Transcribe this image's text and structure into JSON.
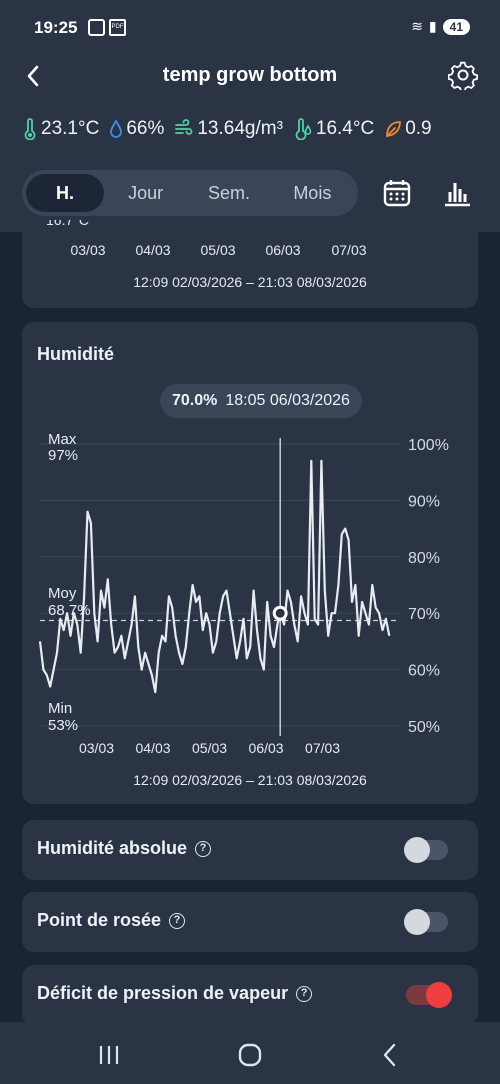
{
  "status": {
    "time": "19:25",
    "battery": "41"
  },
  "header": {
    "title": "temp grow bottom"
  },
  "metrics": [
    {
      "icon": "thermometer-icon",
      "value": "23.1°C",
      "color": "#4fd1a5"
    },
    {
      "icon": "water-drop-icon",
      "value": "66%",
      "color": "#3b8ee8"
    },
    {
      "icon": "wind-water-icon",
      "value": "13.64g/m³",
      "color": "#4fd1a5"
    },
    {
      "icon": "dew-point-icon",
      "value": "16.4°C",
      "color": "#4fd1a5"
    },
    {
      "icon": "leaf-icon",
      "value": "0.9",
      "color": "#f08a2c"
    }
  ],
  "tabs": [
    {
      "label": "H.",
      "active": true
    },
    {
      "label": "Jour",
      "active": false
    },
    {
      "label": "Sem.",
      "active": false
    },
    {
      "label": "Mois",
      "active": false
    }
  ],
  "top_card": {
    "clipped_label": "16.7°C",
    "x_ticks": [
      "03/03",
      "04/03",
      "05/03",
      "06/03",
      "07/03"
    ],
    "range": "12:09 02/03/2026 – 21:03 08/03/2026"
  },
  "humidity_card": {
    "title": "Humidité",
    "tooltip_value": "70.0%",
    "tooltip_time": "18:05 06/03/2026",
    "max_label": "Max",
    "max_value": "97%",
    "avg_label": "Moy",
    "avg_value": "68.7%",
    "min_label": "Min",
    "min_value": "53%",
    "range": "12:09 02/03/2026 – 21:03 08/03/2026"
  },
  "chart_data": {
    "type": "line",
    "title": "Humidité",
    "y_ticks": [
      "100%",
      "90%",
      "80%",
      "70%",
      "60%",
      "50%"
    ],
    "ylim": [
      50,
      100
    ],
    "x_ticks": [
      "03/03",
      "04/03",
      "05/03",
      "06/03",
      "07/03"
    ],
    "xlim": [
      0,
      6.37
    ],
    "avg": 68.7,
    "max": 97,
    "min": 53,
    "cursor": {
      "x": 4.25,
      "y": 70.0
    },
    "x": [
      0,
      0.06,
      0.12,
      0.18,
      0.24,
      0.3,
      0.36,
      0.42,
      0.48,
      0.54,
      0.6,
      0.66,
      0.72,
      0.78,
      0.84,
      0.9,
      0.96,
      1.02,
      1.08,
      1.14,
      1.2,
      1.26,
      1.32,
      1.38,
      1.44,
      1.5,
      1.56,
      1.62,
      1.68,
      1.74,
      1.8,
      1.86,
      1.92,
      1.98,
      2.04,
      2.1,
      2.16,
      2.22,
      2.28,
      2.34,
      2.4,
      2.46,
      2.52,
      2.58,
      2.64,
      2.7,
      2.76,
      2.82,
      2.88,
      2.94,
      3.0,
      3.06,
      3.12,
      3.18,
      3.24,
      3.3,
      3.36,
      3.42,
      3.48,
      3.54,
      3.6,
      3.66,
      3.72,
      3.78,
      3.84,
      3.9,
      3.96,
      4.02,
      4.08,
      4.14,
      4.2,
      4.25,
      4.32,
      4.38,
      4.44,
      4.5,
      4.56,
      4.62,
      4.68,
      4.74,
      4.8,
      4.86,
      4.92,
      4.98,
      5.04,
      5.1,
      5.16,
      5.22,
      5.28,
      5.34,
      5.4,
      5.46,
      5.52,
      5.58,
      5.64,
      5.7,
      5.76,
      5.82,
      5.88,
      5.94,
      6.0,
      6.06,
      6.12,
      6.18
    ],
    "y": [
      65,
      60,
      59,
      57,
      60,
      63,
      69,
      67,
      70,
      66,
      70,
      68,
      63,
      73,
      88,
      86,
      70,
      65,
      74,
      71,
      76,
      68,
      63,
      64,
      66,
      62,
      65,
      68,
      73,
      64,
      60,
      63,
      61,
      59,
      56,
      63,
      66,
      65,
      73,
      71,
      66,
      63,
      61,
      64,
      70,
      75,
      72,
      73,
      67,
      70,
      68,
      63,
      65,
      70,
      73,
      74,
      70,
      66,
      62,
      65,
      69,
      62,
      64,
      74,
      67,
      62,
      60,
      72,
      66,
      64,
      68,
      70,
      68,
      74,
      72,
      68,
      65,
      73,
      70,
      68,
      97,
      69,
      68,
      97,
      74,
      66,
      70,
      70,
      75,
      84,
      85,
      83,
      72,
      75,
      66,
      72,
      70,
      68,
      75,
      71,
      70,
      67,
      69,
      66
    ]
  },
  "toggles": [
    {
      "label": "Humidité absolue",
      "on": false
    },
    {
      "label": "Point de rosée",
      "on": false
    },
    {
      "label": "Déficit de pression de vapeur",
      "on": true
    }
  ]
}
